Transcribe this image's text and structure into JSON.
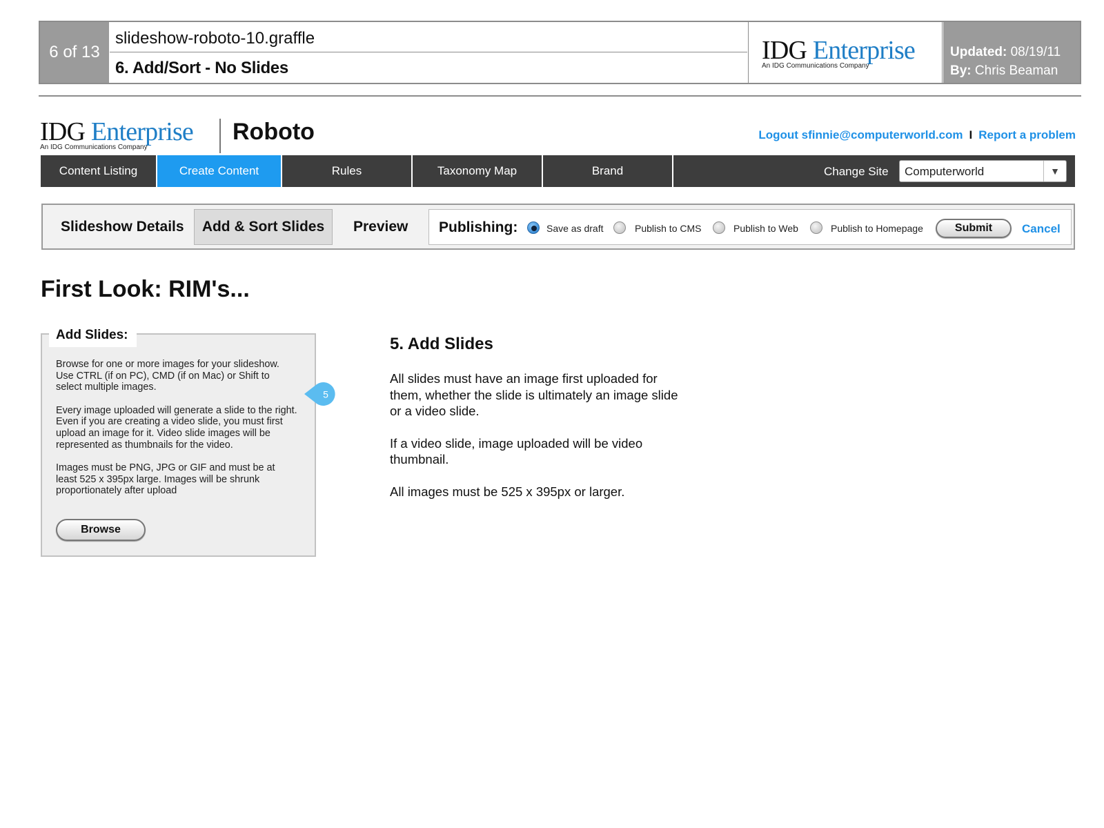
{
  "wireframe": {
    "page_counter": "6 of 13",
    "filename": "slideshow-roboto-10.graffle",
    "screen_title": "6. Add/Sort - No Slides",
    "logo": {
      "name_dark": "IDG",
      "name_accent": "Enterprise",
      "tagline": "An IDG Communications Company"
    },
    "updated_label": "Updated:",
    "updated_value": "08/19/11",
    "by_label": "By:",
    "by_value": "Chris Beaman"
  },
  "app": {
    "logo": {
      "name_dark": "IDG",
      "name_accent": "Enterprise",
      "tagline": "An IDG Communications Company"
    },
    "name": "Roboto",
    "logout_link": "Logout sfinnie@computerworld.com",
    "link_separator": "I",
    "report_link": "Report a problem"
  },
  "nav": {
    "items": [
      {
        "label": "Content Listing",
        "active": false
      },
      {
        "label": "Create Content",
        "active": true
      },
      {
        "label": "Rules",
        "active": false
      },
      {
        "label": "Taxonomy Map",
        "active": false
      },
      {
        "label": "Brand",
        "active": false
      }
    ],
    "change_site_label": "Change Site",
    "site_value": "Computerworld",
    "dropdown_icon": "triangle-down"
  },
  "tabs": {
    "items": [
      {
        "label": "Slideshow Details",
        "active": false
      },
      {
        "label": "Add & Sort Slides",
        "active": true
      },
      {
        "label": "Preview",
        "active": false
      }
    ],
    "publishing": {
      "label": "Publishing:",
      "options": [
        {
          "label": "Save as draft",
          "selected": true
        },
        {
          "label": "Publish to CMS",
          "selected": false
        },
        {
          "label": "Publish to Web",
          "selected": false
        },
        {
          "label": "Publish to Homepage",
          "selected": false
        }
      ],
      "submit_label": "Submit",
      "cancel_label": "Cancel"
    }
  },
  "page_title": "First Look: RIM's...",
  "add_slides": {
    "legend": "Add Slides:",
    "paragraphs": [
      "Browse for one or more images for your slideshow. Use CTRL (if on PC), CMD (if on Mac) or Shift to select multiple images.",
      "Every image uploaded will generate a slide to the right. Even if you are creating a video slide, you must first upload an image for it. Video slide images will be represented as thumbnails for the video.",
      "Images must be PNG, JPG or GIF and must be at least 525 x 395px large. Images will be shrunk proportionately after upload"
    ],
    "browse_label": "Browse",
    "callout_number": "5",
    "callout_color": "#5bbcf0"
  },
  "annotation": {
    "title": "5. Add Slides",
    "paragraphs": [
      "All slides must have an image first uploaded for them, whether the slide is ultimately an image slide or a video slide.",
      "If a video slide, image uploaded will be video thumbnail.",
      "All images must be 525 x 395px or larger."
    ]
  },
  "colors": {
    "accent_blue": "#1e90e6",
    "nav_active": "#1e9bf0",
    "nav_bg": "#3d3d3d",
    "wireframe_grey": "#9b9b9b",
    "logo_blue": "#1f7ec6"
  }
}
